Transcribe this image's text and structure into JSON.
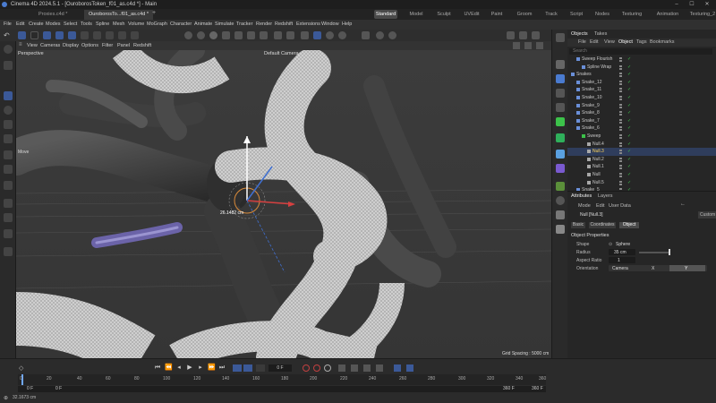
{
  "window": {
    "title": "Cinema 4D 2024.5.1 - [OuroborosToken_f01_as.c4d *] - Main"
  },
  "doc_tabs": [
    "Proxies.c4d *",
    "OuroborosTo...f01_as.c4d *"
  ],
  "layout_tabs": [
    "Standard",
    "Model",
    "Sculpt",
    "UVEdit",
    "Paint",
    "Groom",
    "Track",
    "Script",
    "Nodes",
    "Texturing",
    "Animation",
    "Texturing_2"
  ],
  "menu": [
    "File",
    "Edit",
    "Create",
    "Modes",
    "Select",
    "Tools",
    "Spline",
    "Mesh",
    "Volume",
    "MoGraph",
    "Character",
    "Animate",
    "Simulate",
    "Tracker",
    "Render",
    "Redshift",
    "Extensions",
    "Window",
    "Help"
  ],
  "viewport_menu": [
    "View",
    "Cameras",
    "Display",
    "Options",
    "Filter",
    "Panel",
    "Redshift"
  ],
  "viewport": {
    "name": "Perspective",
    "camera": "Default Camera",
    "mode_label": "Move",
    "measure": "26.1482 cm",
    "grid_spacing": "Grid Spacing : 5000 cm"
  },
  "objects_panel": {
    "tabs": [
      "Objects",
      "Takes"
    ],
    "menu": [
      "File",
      "Edit",
      "View",
      "Object",
      "Tags",
      "Bookmarks"
    ],
    "search_placeholder": "Search",
    "rows": [
      {
        "name": "Sweep Flourish",
        "indent": 1
      },
      {
        "name": "Spline Wrap",
        "indent": 2
      },
      {
        "name": "Snakes",
        "indent": 0
      },
      {
        "name": "Snake_12",
        "indent": 1
      },
      {
        "name": "Snake_11",
        "indent": 1
      },
      {
        "name": "Snake_10",
        "indent": 1
      },
      {
        "name": "Snake_9",
        "indent": 1
      },
      {
        "name": "Snake_8",
        "indent": 1
      },
      {
        "name": "Snake_7",
        "indent": 1
      },
      {
        "name": "Snake_6",
        "indent": 1
      },
      {
        "name": "Sweep",
        "indent": 2
      },
      {
        "name": "Null.4",
        "indent": 3
      },
      {
        "name": "Null.3",
        "indent": 3
      },
      {
        "name": "Null.2",
        "indent": 3
      },
      {
        "name": "Null.1",
        "indent": 3
      },
      {
        "name": "Null",
        "indent": 3
      },
      {
        "name": "Null.5",
        "indent": 3
      },
      {
        "name": "Snake_5",
        "indent": 1
      }
    ]
  },
  "attributes_panel": {
    "tabs": [
      "Attributes",
      "Layers"
    ],
    "menu": [
      "Mode",
      "Edit",
      "User Data"
    ],
    "custom_label": "Custom",
    "object_title": "Null [Null.3]",
    "subtabs": [
      "Basic",
      "Coordinates",
      "Object"
    ],
    "section": "Object Properties",
    "fields": {
      "shape_label": "Shape",
      "shape_value": "Sphere",
      "radius_label": "Radius",
      "radius_value": "35 cm",
      "aspect_label": "Aspect Ratio",
      "aspect_value": "1",
      "orientation_label": "Orientation",
      "orientation_options": [
        "Camera",
        "X",
        "Y"
      ]
    }
  },
  "timeline": {
    "ticks": [
      "0",
      "20",
      "40",
      "60",
      "80",
      "100",
      "120",
      "140",
      "160",
      "180",
      "200",
      "220",
      "240",
      "260",
      "280",
      "300",
      "320",
      "340",
      "360"
    ],
    "current_frame": "0 F",
    "start_frame": "0 F",
    "start_frame2": "0 F",
    "end_frame": "360 F",
    "end_frame2": "360 F",
    "status": "32.1673 cm"
  },
  "colors": {
    "accent": "#3a6fd8",
    "active_mode": "#3b5998",
    "axis_x": "#d64040",
    "axis_y": "#ffffff",
    "axis_z": "#3f6fd0",
    "check": "#3cc24a"
  }
}
